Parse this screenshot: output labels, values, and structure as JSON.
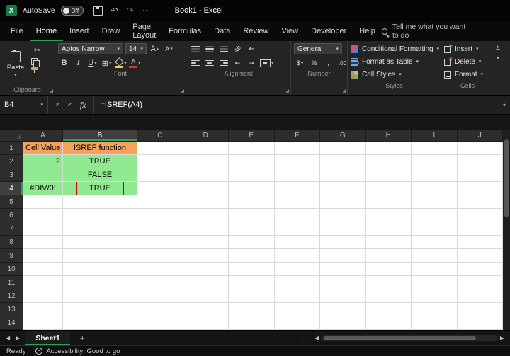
{
  "icons": {
    "excel_x": "X",
    "chevron_down": "▾",
    "triangle_up": "▴",
    "undo": "↶",
    "redo": "↷",
    "menu_dots": "⋯",
    "scissors": "✂",
    "borders": "⊞",
    "wrap": "↩",
    "indent_dec": "⇤",
    "indent_inc": "⇥",
    "check": "✓",
    "close": "×",
    "left_arrow": "◀",
    "right_arrow": "▶",
    "plus": "+",
    "kebab": "⋮",
    "sigma": "Σ",
    "grow_a": "A",
    "shrink_a": "A",
    "font_a": "A",
    "launcher": "◢"
  },
  "colors": {
    "header_fill": "#F5A25A",
    "data_fill": "#90E890",
    "annotation": "#D40000",
    "accent": "#2E9E5B",
    "fill_swatch": "#F2CC3D",
    "fontcolor_swatch": "#D03A2B"
  },
  "titlebar": {
    "autosave_label": "AutoSave",
    "autosave_state": "Off",
    "document_title": "Book1 - Excel"
  },
  "menubar": {
    "tabs": [
      "File",
      "Home",
      "Insert",
      "Draw",
      "Page Layout",
      "Formulas",
      "Data",
      "Review",
      "View",
      "Developer",
      "Help"
    ],
    "active_tab": "Home",
    "search_text": "Tell me what you want to do"
  },
  "ribbon": {
    "clipboard": {
      "group_label": "Clipboard",
      "paste_label": "Paste"
    },
    "font": {
      "group_label": "Font",
      "font_name": "Aptos Narrow",
      "font_size": "14",
      "bold": "B",
      "italic": "I",
      "underline": "U"
    },
    "alignment": {
      "group_label": "Alignment"
    },
    "number": {
      "group_label": "Number",
      "format": "General",
      "accounting": "$",
      "percent": "%",
      "comma": ",",
      "dec_dec": ".0",
      "dec_inc": ".00"
    },
    "styles": {
      "group_label": "Styles",
      "conditional_formatting": "Conditional Formatting",
      "format_as_table": "Format as Table",
      "cell_styles": "Cell Styles"
    },
    "cells": {
      "group_label": "Cells",
      "insert": "Insert",
      "delete": "Delete",
      "format": "Format"
    }
  },
  "formula_bar": {
    "name_box": "B4",
    "fx_label": "fx",
    "formula": "=ISREF(A4)"
  },
  "grid": {
    "column_headers": [
      "A",
      "B",
      "C",
      "D",
      "E",
      "F",
      "G",
      "H",
      "I",
      "J"
    ],
    "row_headers": [
      "1",
      "2",
      "3",
      "4",
      "5",
      "6",
      "7",
      "8",
      "9",
      "10",
      "11",
      "12",
      "13",
      "14"
    ],
    "selected_cell": "B4",
    "cells": [
      {
        "col": "A",
        "row": "1",
        "text": "Cell Value",
        "bg": "header_fill",
        "align": "left"
      },
      {
        "col": "B",
        "row": "1",
        "text": "ISREF function",
        "bg": "header_fill",
        "align": "center"
      },
      {
        "col": "A",
        "row": "2",
        "text": "2",
        "bg": "data_fill",
        "align": "right"
      },
      {
        "col": "B",
        "row": "2",
        "text": "TRUE",
        "bg": "data_fill",
        "align": "center"
      },
      {
        "col": "A",
        "row": "3",
        "text": "",
        "bg": "data_fill",
        "align": "left"
      },
      {
        "col": "B",
        "row": "3",
        "text": "FALSE",
        "bg": "data_fill",
        "align": "center"
      },
      {
        "col": "A",
        "row": "4",
        "text": "#DIV/0!",
        "bg": "data_fill",
        "align": "center"
      },
      {
        "col": "B",
        "row": "4",
        "text": "TRUE",
        "bg": "data_fill",
        "align": "center",
        "annotated": true
      }
    ]
  },
  "sheetbar": {
    "tabs": [
      "Sheet1"
    ],
    "active_tab": "Sheet1"
  },
  "statusbar": {
    "mode": "Ready",
    "accessibility": "Accessibility: Good to go"
  }
}
